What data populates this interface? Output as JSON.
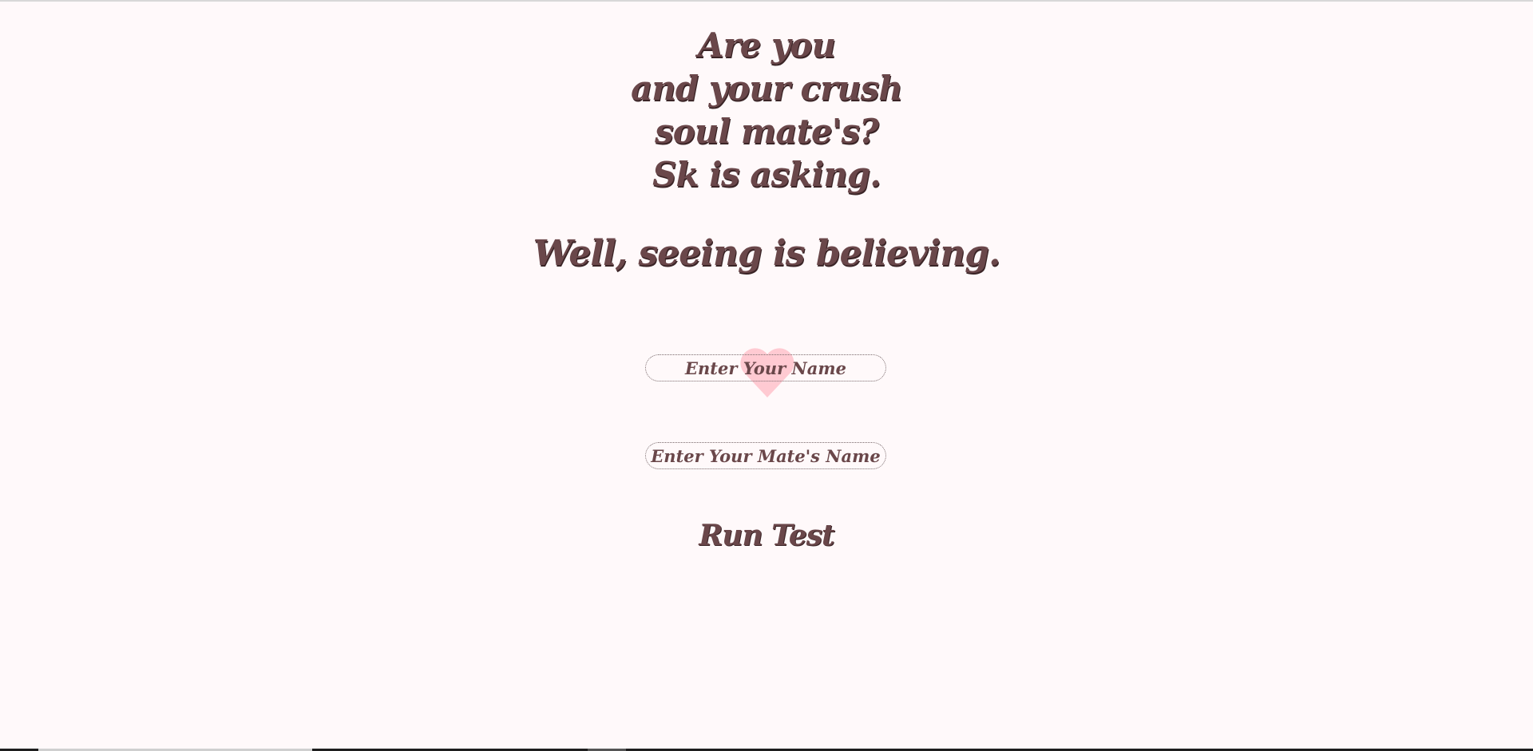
{
  "headline": {
    "lines": [
      "Are you",
      "and your crush",
      "soul mate's?",
      "Sk is asking."
    ]
  },
  "subline": "Well, seeing is believing.",
  "form": {
    "name_placeholder": "Enter Your Name",
    "mate_placeholder": "Enter Your Mate's Name",
    "run_label": "Run Test"
  },
  "colors": {
    "background": "#fff9fa",
    "text": "#6a474a",
    "heart": "#ffc4cd"
  },
  "icons": {
    "heart": "heart-icon"
  }
}
